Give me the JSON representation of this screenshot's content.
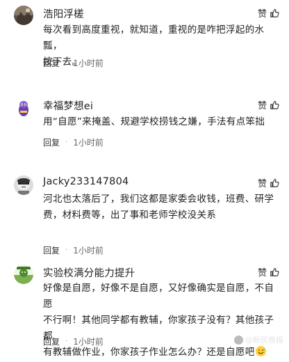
{
  "comments": [
    {
      "username": "浩阳浮槎",
      "like_label": "赞",
      "content": "每次看到高度重视，就知道，重视的是咋把浮起的水瓢，\n按下去。",
      "reply_label": "回复",
      "dot": "·",
      "time": "1小时前"
    },
    {
      "username": "幸福梦想ei",
      "like_label": "赞",
      "content": "用“自愿”来掩盖、规避学校捞钱之嫌，手法有点笨拙",
      "reply_label": "回复",
      "dot": "·",
      "time": "1小时前"
    },
    {
      "username": "Jacky233147804",
      "like_label": "赞",
      "content": "河北也太落后了，我们这都是家委会收钱，班费、研学\n费，材料费等，出了事和老师学校没关系",
      "reply_label": "回复",
      "dot": "·",
      "time": "1小时前"
    },
    {
      "username": "实验校满分能力提升",
      "like_label": "赞",
      "content": "好像是自愿，好像不是自愿，又好像确实是自愿，不自愿\n不行啊！其他同学都有教辅，你家孩子没有？其他孩子都\n有教辅做作业，你家孩子作业怎么办？还是自愿吧",
      "reply_label": "回复",
      "dot": "·",
      "time": "1小时前"
    }
  ],
  "watermark": "@新民晚报",
  "colors": {
    "text": "#222222",
    "meta": "#555555",
    "background": "#ffffff"
  },
  "icons": {
    "like": "thumbs-up-icon",
    "emoji": "sweat-smile-emoji-icon"
  }
}
